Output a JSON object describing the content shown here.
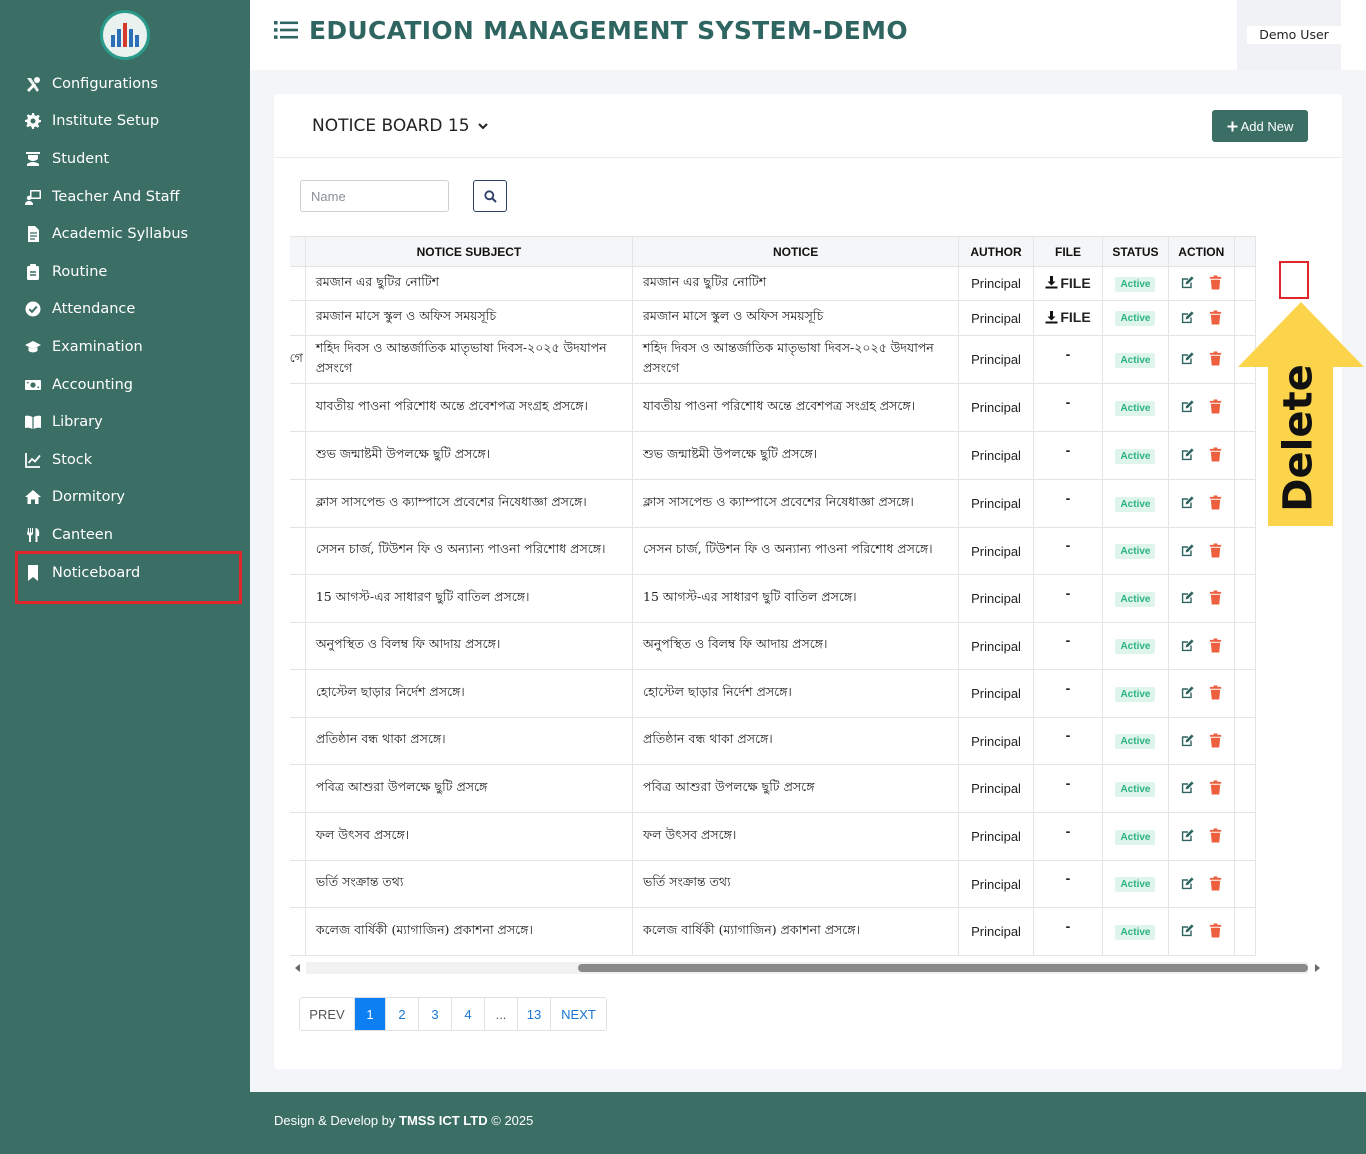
{
  "app_title": "EDUCATION MANAGEMENT SYSTEM-DEMO",
  "user": {
    "name": "Demo User"
  },
  "sidebar": {
    "items": [
      {
        "label": "Configurations",
        "icon": "tools-icon"
      },
      {
        "label": "Institute Setup",
        "icon": "gear-icon"
      },
      {
        "label": "Student",
        "icon": "student-icon"
      },
      {
        "label": "Teacher And Staff",
        "icon": "teacher-icon"
      },
      {
        "label": "Academic Syllabus",
        "icon": "document-icon"
      },
      {
        "label": "Routine",
        "icon": "clipboard-icon"
      },
      {
        "label": "Attendance",
        "icon": "check-circle-icon"
      },
      {
        "label": "Examination",
        "icon": "graduation-cap-icon"
      },
      {
        "label": "Accounting",
        "icon": "money-icon"
      },
      {
        "label": "Library",
        "icon": "book-icon"
      },
      {
        "label": "Stock",
        "icon": "chart-line-icon"
      },
      {
        "label": "Dormitory",
        "icon": "home-icon"
      },
      {
        "label": "Canteen",
        "icon": "utensils-icon"
      },
      {
        "label": "Noticeboard",
        "icon": "bookmark-icon"
      }
    ]
  },
  "card": {
    "title": "NOTICE BOARD 15",
    "add_button": "Add New",
    "search_placeholder": "Name"
  },
  "table": {
    "columns": [
      "NOTICE SUBJECT",
      "NOTICE",
      "AUTHOR",
      "FILE",
      "STATUS",
      "ACTION"
    ],
    "clipped_first_cell": "গে",
    "rows": [
      {
        "subject": "রমজান এর ছুটির নোটিশ",
        "notice": "রমজান এর ছুটির নোটিশ",
        "author": "Principal",
        "file": "FILE",
        "status": "Active"
      },
      {
        "subject": "রমজান মাসে স্কুল ও অফিস সময়সূচি",
        "notice": "রমজান মাসে স্কুল ও অফিস সময়সূচি",
        "author": "Principal",
        "file": "FILE",
        "status": "Active"
      },
      {
        "subject": "শহিদ দিবস ও আন্তর্জাতিক মাতৃভাষা দিবস-২০২৫ উদযাপন প্রসংগে",
        "notice": "শহিদ দিবস ও আন্তর্জাতিক মাতৃভাষা দিবস-২০২৫ উদযাপন প্রসংগে",
        "author": "Principal",
        "file": "-",
        "status": "Active"
      },
      {
        "subject": "যাবতীয় পাওনা পরিশোধ অন্তে প্রবেশপত্র সংগ্রহ প্রসঙ্গে।",
        "notice": "যাবতীয় পাওনা পরিশোধ অন্তে প্রবেশপত্র সংগ্রহ প্রসঙ্গে।",
        "author": "Principal",
        "file": "-",
        "status": "Active"
      },
      {
        "subject": "শুভ জন্মাষ্টমী উপলক্ষে ছুটি প্রসঙ্গে।",
        "notice": "শুভ জন্মাষ্টমী উপলক্ষে ছুটি প্রসঙ্গে।",
        "author": "Principal",
        "file": "-",
        "status": "Active"
      },
      {
        "subject": "ক্লাস সাসপেন্ড ও ক্যাম্পাসে প্রবেশের নিষেধাজ্ঞা প্রসঙ্গে।",
        "notice": "ক্লাস সাসপেন্ড ও ক্যাম্পাসে প্রবেশের নিষেধাজ্ঞা প্রসঙ্গে।",
        "author": "Principal",
        "file": "-",
        "status": "Active"
      },
      {
        "subject": "সেসন চার্জ, টিউশন ফি ও অন্যান্য পাওনা পরিশোধ প্রসঙ্গে।",
        "notice": "সেসন চার্জ, টিউশন ফি ও অন্যান্য পাওনা পরিশোধ প্রসঙ্গে।",
        "author": "Principal",
        "file": "-",
        "status": "Active"
      },
      {
        "subject": "15 আগস্ট-এর সাধারণ ছুটি বাতিল প্রসঙ্গে।",
        "notice": "15 আগস্ট-এর সাধারণ ছুটি বাতিল প্রসঙ্গে।",
        "author": "Principal",
        "file": "-",
        "status": "Active"
      },
      {
        "subject": "অনুপস্থিত ও বিলম্ব ফি আদায় প্রসঙ্গে।",
        "notice": "অনুপস্থিত ও বিলম্ব ফি আদায় প্রসঙ্গে।",
        "author": "Principal",
        "file": "-",
        "status": "Active"
      },
      {
        "subject": "হোস্টেল ছাড়ার নির্দেশ প্রসঙ্গে।",
        "notice": "হোস্টেল ছাড়ার নির্দেশ প্রসঙ্গে।",
        "author": "Principal",
        "file": "-",
        "status": "Active"
      },
      {
        "subject": "প্রতিষ্ঠান বন্ধ থাকা প্রসঙ্গে।",
        "notice": "প্রতিষ্ঠান বন্ধ থাকা প্রসঙ্গে।",
        "author": "Principal",
        "file": "-",
        "status": "Active"
      },
      {
        "subject": "পবিত্র আশুরা উপলক্ষে ছুটি প্রসঙ্গে",
        "notice": "পবিত্র আশুরা উপলক্ষে ছুটি প্রসঙ্গে",
        "author": "Principal",
        "file": "-",
        "status": "Active"
      },
      {
        "subject": "ফল উৎসব প্রসঙ্গে।",
        "notice": "ফল উৎসব প্রসঙ্গে।",
        "author": "Principal",
        "file": "-",
        "status": "Active"
      },
      {
        "subject": "ভর্তি সংক্রান্ত তথ্য",
        "notice": "ভর্তি সংক্রান্ত তথ্য",
        "author": "Principal",
        "file": "-",
        "status": "Active"
      },
      {
        "subject": "কলেজ বার্ষিকী (ম্যাগাজিন) প্রকাশনা প্রসঙ্গে।",
        "notice": "কলেজ বার্ষিকী (ম্যাগাজিন) প্রকাশনা প্রসঙ্গে।",
        "author": "Principal",
        "file": "-",
        "status": "Active"
      }
    ]
  },
  "annotation": {
    "label": "Delete"
  },
  "pagination": {
    "prev": "PREV",
    "pages": [
      "1",
      "2",
      "3",
      "4",
      "...",
      "13"
    ],
    "next": "NEXT",
    "current": "1"
  },
  "footer": {
    "prefix": "Design & Develop by",
    "company": "TMSS ICT LTD",
    "suffix": "© 2025"
  },
  "colors": {
    "primary": "#3b6e65",
    "delete": "#ec5f3f",
    "edit": "#2f6560",
    "active_badge": "#2bb37f",
    "highlight": "#e0262b",
    "arrow": "#fbd44c"
  }
}
